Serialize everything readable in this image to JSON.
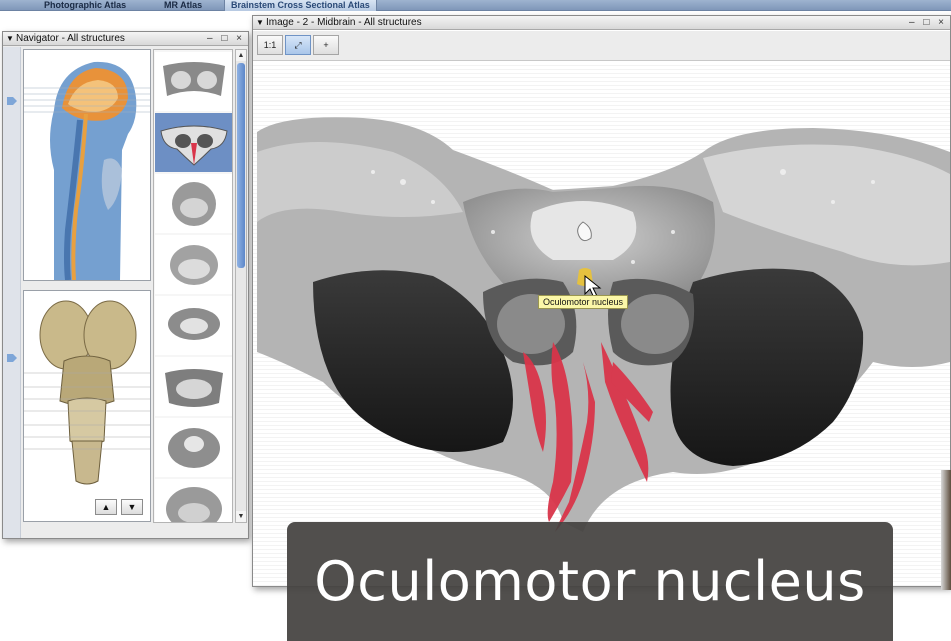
{
  "tabs": [
    {
      "label": "Photographic Atlas",
      "active": false
    },
    {
      "label": "MR Atlas",
      "active": false
    },
    {
      "label": "Brainstem Cross Sectional Atlas",
      "active": true
    }
  ],
  "navigator": {
    "title": "Navigator - All structures",
    "controls": "– □ ×",
    "up_label": "▲",
    "down_label": "▼",
    "scroll_up": "▲",
    "scroll_down": "▼",
    "thumbnail_count": 8,
    "selected_thumbnail": 2
  },
  "image_window": {
    "title": "Image - 2 - Midbrain - All structures",
    "controls": "– □ ×",
    "tool_zoom": "1:1",
    "tool_fit": "⤢",
    "tool_pointer": "+"
  },
  "tooltip": "Oculomotor nucleus",
  "caption": "Oculomotor nucleus",
  "colors": {
    "highlight_structure": "#d9354a",
    "tab_active": "#2b4a77",
    "caption_bg": "#444240"
  }
}
